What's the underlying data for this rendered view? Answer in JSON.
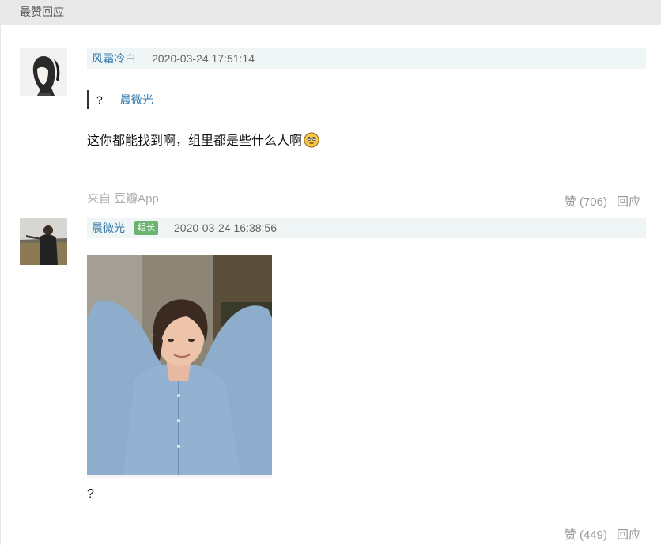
{
  "section": {
    "title": "最赞回应"
  },
  "comments": [
    {
      "author": "风霜冷白",
      "timestamp": "2020-03-24 17:51:14",
      "quote": {
        "text": "?",
        "author": "晨微光"
      },
      "text": "这你都能找到啊，组里都是些什么人啊",
      "emoji": "flushed-face-emoji",
      "source": "来自 豆瓣App",
      "like_label": "赞 (706)",
      "reply_label": "回应"
    },
    {
      "author": "晨微光",
      "badge": "组长",
      "timestamp": "2020-03-24 16:38:56",
      "photo": "woman-in-blue-shirt-photo",
      "text": "?",
      "like_label": "赞 (449)",
      "reply_label": "回应"
    }
  ],
  "colors": {
    "link": "#3377aa",
    "meta_bg": "#f0f6f5",
    "badge_bg": "#6bb46f",
    "header_bg": "#e9e9e9"
  }
}
